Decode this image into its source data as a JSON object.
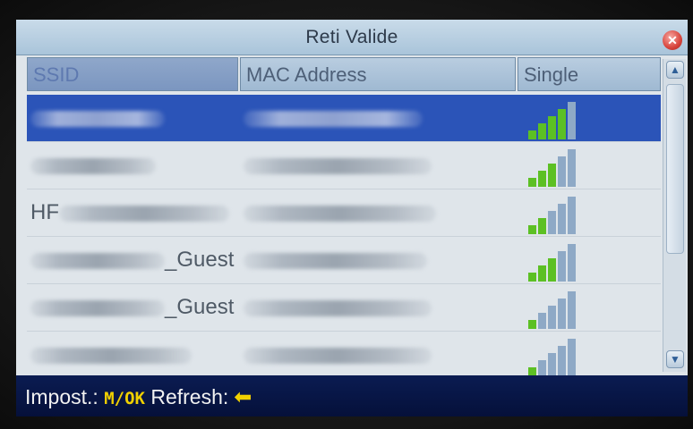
{
  "window": {
    "title": "Reti Valide",
    "close_icon": "close-icon"
  },
  "table": {
    "columns": [
      "SSID",
      "MAC Address",
      "Single"
    ],
    "selected_row": 0,
    "rows": [
      {
        "ssid_visible": "",
        "mac_visible": "",
        "signal_bars": 4,
        "signal_total": 5
      },
      {
        "ssid_visible": "",
        "mac_visible": "",
        "signal_bars": 3,
        "signal_total": 5
      },
      {
        "ssid_visible": "HF",
        "mac_visible": "",
        "signal_bars": 2,
        "signal_total": 5
      },
      {
        "ssid_visible": "_Guest",
        "mac_visible": "",
        "signal_bars": 3,
        "signal_total": 5
      },
      {
        "ssid_visible": "_Guest",
        "mac_visible": "",
        "signal_bars": 1,
        "signal_total": 5
      },
      {
        "ssid_visible": "",
        "mac_visible": "",
        "signal_bars": 1,
        "signal_total": 5
      }
    ]
  },
  "footer": {
    "impost_label": "Impost.:",
    "impost_key": "M/OK",
    "refresh_label": "Refresh:",
    "refresh_icon": "left-arrow-icon"
  },
  "colors": {
    "signal_on": "#5cc024",
    "signal_off": "#8ea9c6",
    "selected_row": "#2b54b8",
    "footer_bg": "#0b1c52",
    "footer_accent": "#f0d000"
  }
}
